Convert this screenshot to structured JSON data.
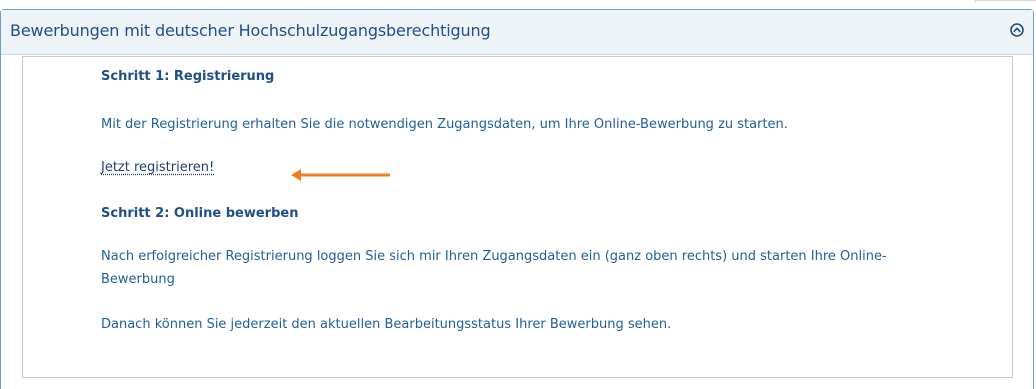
{
  "panel": {
    "title": "Bewerbungen mit deutscher Hochschulzugangsberechtigung",
    "collapse_icon": "chevron-up-circle-icon",
    "accent_color": "#1f4f86",
    "arrow_color": "#ef7d22"
  },
  "content": {
    "step1_heading": "Schritt 1: Registrierung",
    "step1_text": "Mit der Registrierung erhalten Sie die notwendigen Zugangsdaten, um Ihre Online-Bewerbung zu starten.",
    "register_link": "Jetzt registrieren!",
    "step2_heading": "Schritt 2: Online bewerben",
    "step2_text_line1": "Nach erfolgreicher Registrierung loggen Sie sich mir Ihren Zugangsdaten ein (ganz oben rechts) und starten Ihre Online-",
    "step2_text_line2": "Bewerbung",
    "status_text": "Danach können Sie jederzeit den aktuellen Bearbeitungsstatus Ihrer Bewerbung sehen."
  }
}
